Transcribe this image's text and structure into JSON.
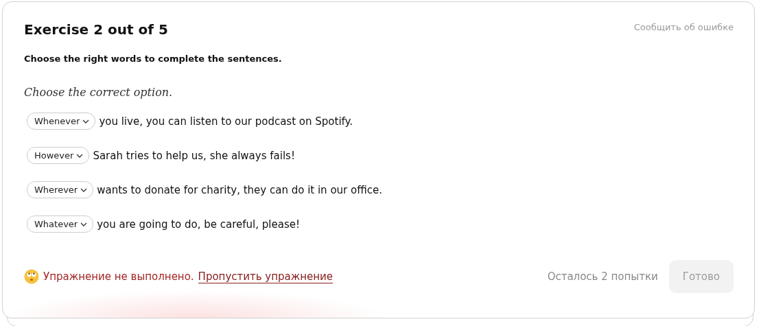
{
  "title": "Exercise 2 out of 5",
  "report_link": "Сообщить об ошибке",
  "instruction": "Choose the right words to complete the sentences.",
  "prompt": "Choose the correct option.",
  "sentences": [
    {
      "choice": "Whenever",
      "text": "you live, you can listen to our podcast on Spotify."
    },
    {
      "choice": "However",
      "text": "Sarah tries to help us, she always fails!"
    },
    {
      "choice": "Wherever",
      "text": "wants to donate for charity, they can do it in our office."
    },
    {
      "choice": "Whatever",
      "text": "you are going to do, be careful, please!"
    }
  ],
  "status": {
    "message": "Упражнение не выполнено.",
    "skip_link": "Пропустить упражнение"
  },
  "attempts": "Осталось 2 попытки",
  "done_button": {
    "label": "Готово",
    "disabled": true
  }
}
